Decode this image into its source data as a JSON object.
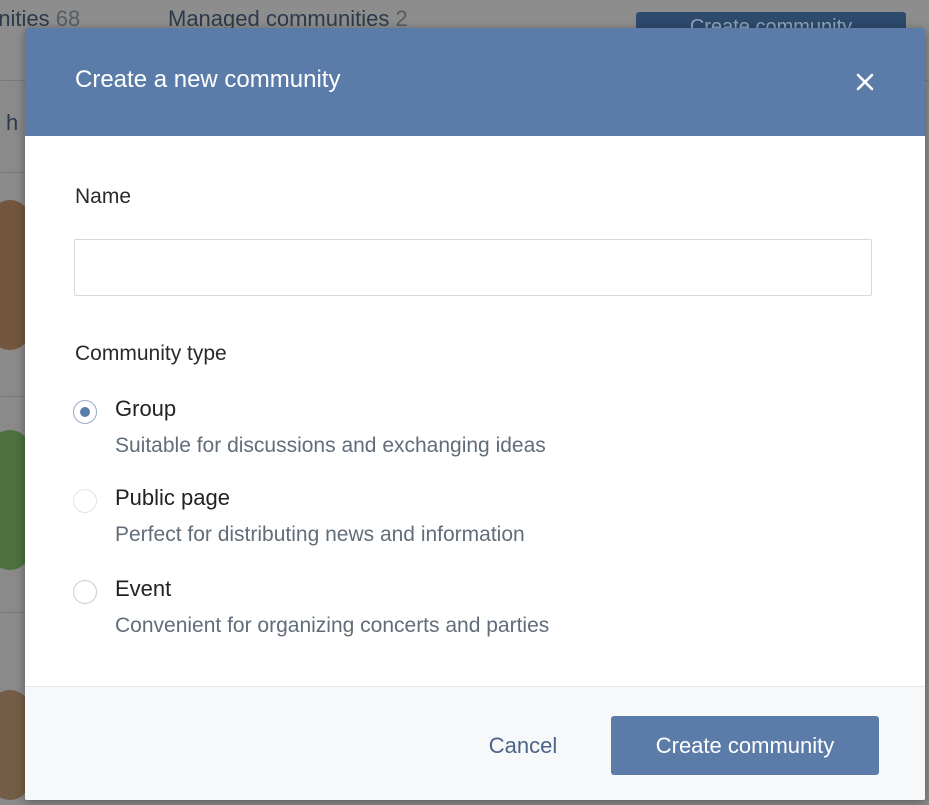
{
  "background_page": {
    "tab_all": "unities",
    "tab_all_count": "68",
    "tab_managed": "Managed communities",
    "tab_managed_count": "2",
    "create_button": "Create community",
    "partial_heading": "h"
  },
  "modal": {
    "title": "Create a new community",
    "close_icon": "close-icon",
    "name_label": "Name",
    "name_value": "",
    "name_placeholder": "",
    "type_label": "Community type",
    "options": [
      {
        "id": "group",
        "label": "Group",
        "description": "Suitable for discussions and exchanging ideas",
        "checked": true
      },
      {
        "id": "public",
        "label": "Public page",
        "description": "Perfect for distributing news and information",
        "checked": false
      },
      {
        "id": "event",
        "label": "Event",
        "description": "Convenient for organizing concerts and parties",
        "checked": false
      }
    ],
    "cancel_label": "Cancel",
    "create_label": "Create community"
  },
  "colors": {
    "accent": "#5b7ca8",
    "header_bg": "#5b7ca8",
    "link": "#4a6588",
    "muted_text": "#626d7a"
  }
}
